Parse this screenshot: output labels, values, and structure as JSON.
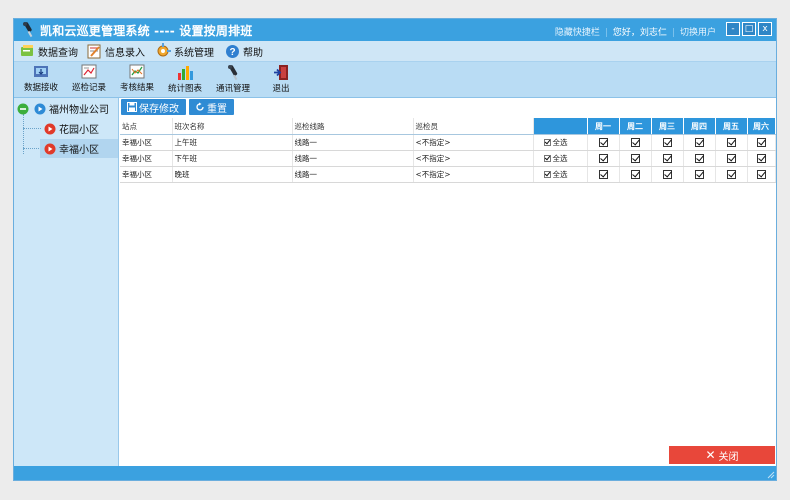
{
  "window": {
    "title": "凯和云巡更管理系统 ---- 设置按周排班",
    "links": {
      "hide_shortcut": "隐藏快捷栏",
      "greeting": "您好，刘志仁",
      "switch_user": "切换用户"
    },
    "buttons": {
      "minimize": "-",
      "maximize": "□",
      "close": "x"
    }
  },
  "menu": [
    {
      "label": "数据查询",
      "icon": "data-query-icon"
    },
    {
      "label": "信息录入",
      "icon": "info-entry-icon"
    },
    {
      "label": "系统管理",
      "icon": "system-gear-icon"
    },
    {
      "label": "帮助",
      "icon": "help-icon"
    }
  ],
  "toolbar": [
    {
      "label": "数据接收",
      "icon": "data-receive-icon"
    },
    {
      "label": "巡检记录",
      "icon": "inspection-record-icon"
    },
    {
      "label": "考核结果",
      "icon": "assessment-result-icon"
    },
    {
      "label": "统计图表",
      "icon": "statistics-chart-icon"
    },
    {
      "label": "通讯管理",
      "icon": "communication-icon"
    },
    {
      "label": "退出",
      "icon": "exit-icon"
    }
  ],
  "tree": {
    "root": "福州物业公司",
    "children": [
      "花园小区",
      "幸福小区"
    ],
    "selected_index": 1
  },
  "actions": {
    "save": "保存修改",
    "reset": "重置"
  },
  "table": {
    "columns": [
      "站点",
      "班次名称",
      "巡检线路",
      "巡检员"
    ],
    "days": [
      "周一",
      "周二",
      "周三",
      "周四",
      "周五",
      "周六"
    ],
    "select_all_label": "全选",
    "rows": [
      {
        "site": "幸福小区",
        "shift": "上午班",
        "route": "线路一",
        "inspector": "<不指定>",
        "all": true,
        "days": [
          true,
          true,
          true,
          true,
          true,
          true
        ]
      },
      {
        "site": "幸福小区",
        "shift": "下午班",
        "route": "线路一",
        "inspector": "<不指定>",
        "all": true,
        "days": [
          true,
          true,
          true,
          true,
          true,
          true
        ]
      },
      {
        "site": "幸福小区",
        "shift": "晚班",
        "route": "线路一",
        "inspector": "<不指定>",
        "all": true,
        "days": [
          true,
          true,
          true,
          true,
          true,
          true
        ]
      }
    ]
  },
  "close_button": "关闭",
  "colors": {
    "titlebar": "#3ba1e0",
    "menubar": "#cfe6f6",
    "toolbar": "#b9dcf4",
    "tree": "#cde7f8",
    "day_header": "#2e96dc",
    "close": "#e8473a"
  }
}
